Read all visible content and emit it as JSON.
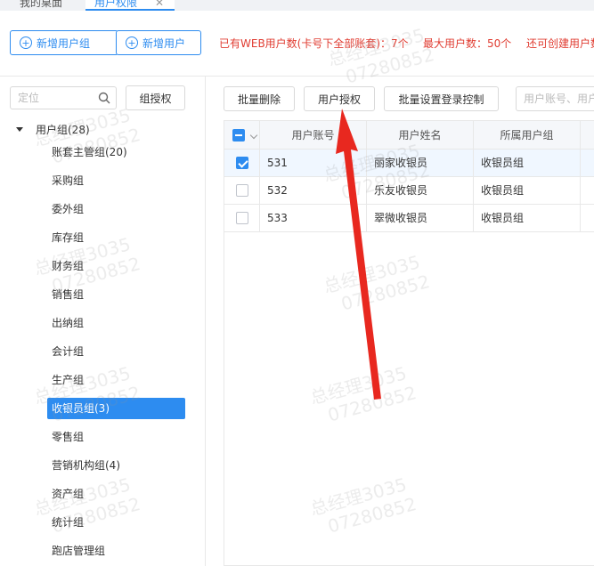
{
  "tabs": [
    {
      "label": "我的桌面"
    },
    {
      "label": "用户权限",
      "close": "✕"
    }
  ],
  "toolbar": {
    "add_group_label": "新增用户组",
    "add_user_label": "新增用户",
    "web_users_text": "已有WEB用户数(卡号下全部账套)：7个",
    "max_users_text": "最大用户数：50个",
    "remaining_text": "还可创建用户数"
  },
  "left": {
    "search_placeholder": "定位",
    "group_auth_label": "组授权",
    "root": "用户组(28)",
    "groups": [
      "账套主管组(20)",
      "采购组",
      "委外组",
      "库存组",
      "财务组",
      "销售组",
      "出纳组",
      "会计组",
      "生产组",
      "收银员组(3)",
      "零售组",
      "营销机构组(4)",
      "资产组",
      "统计组",
      "跑店管理组"
    ],
    "active_index": 9
  },
  "actions": {
    "batch_delete": "批量删除",
    "user_auth": "用户授权",
    "batch_login": "批量设置登录控制",
    "search_placeholder": "用户账号、用户"
  },
  "table": {
    "headers": [
      "用户账号",
      "用户姓名",
      "所属用户组"
    ],
    "rows": [
      {
        "account": "531",
        "name": "丽家收银员",
        "group": "收银员组",
        "checked": true
      },
      {
        "account": "532",
        "name": "乐友收银员",
        "group": "收银员组",
        "checked": false
      },
      {
        "account": "533",
        "name": "翠微收银员",
        "group": "收银员组",
        "checked": false
      }
    ]
  },
  "watermark": {
    "line1": "总经理3035",
    "line2": "07280852"
  },
  "colors": {
    "accent": "#2d8cf0",
    "warning_text": "#e03c31",
    "arrow": "#e8281f"
  }
}
